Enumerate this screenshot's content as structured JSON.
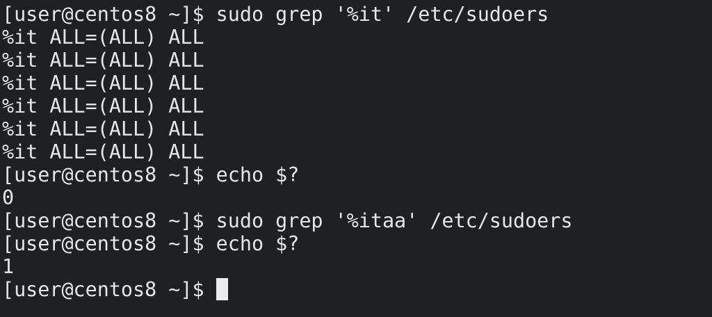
{
  "terminal": {
    "prompt": "[user@centos8 ~]$ ",
    "lines": [
      "[user@centos8 ~]$ sudo grep '%it' /etc/sudoers",
      "%it ALL=(ALL) ALL",
      "%it ALL=(ALL) ALL",
      "%it ALL=(ALL) ALL",
      "%it ALL=(ALL) ALL",
      "%it ALL=(ALL) ALL",
      "%it ALL=(ALL) ALL",
      "[user@centos8 ~]$ echo $?",
      "0",
      "[user@centos8 ~]$ sudo grep '%itaa' /etc/sudoers",
      "[user@centos8 ~]$ echo $?",
      "1"
    ],
    "colors": {
      "background": "#1e2124",
      "foreground": "#e6e6e6",
      "cursor": "#ececec"
    }
  }
}
